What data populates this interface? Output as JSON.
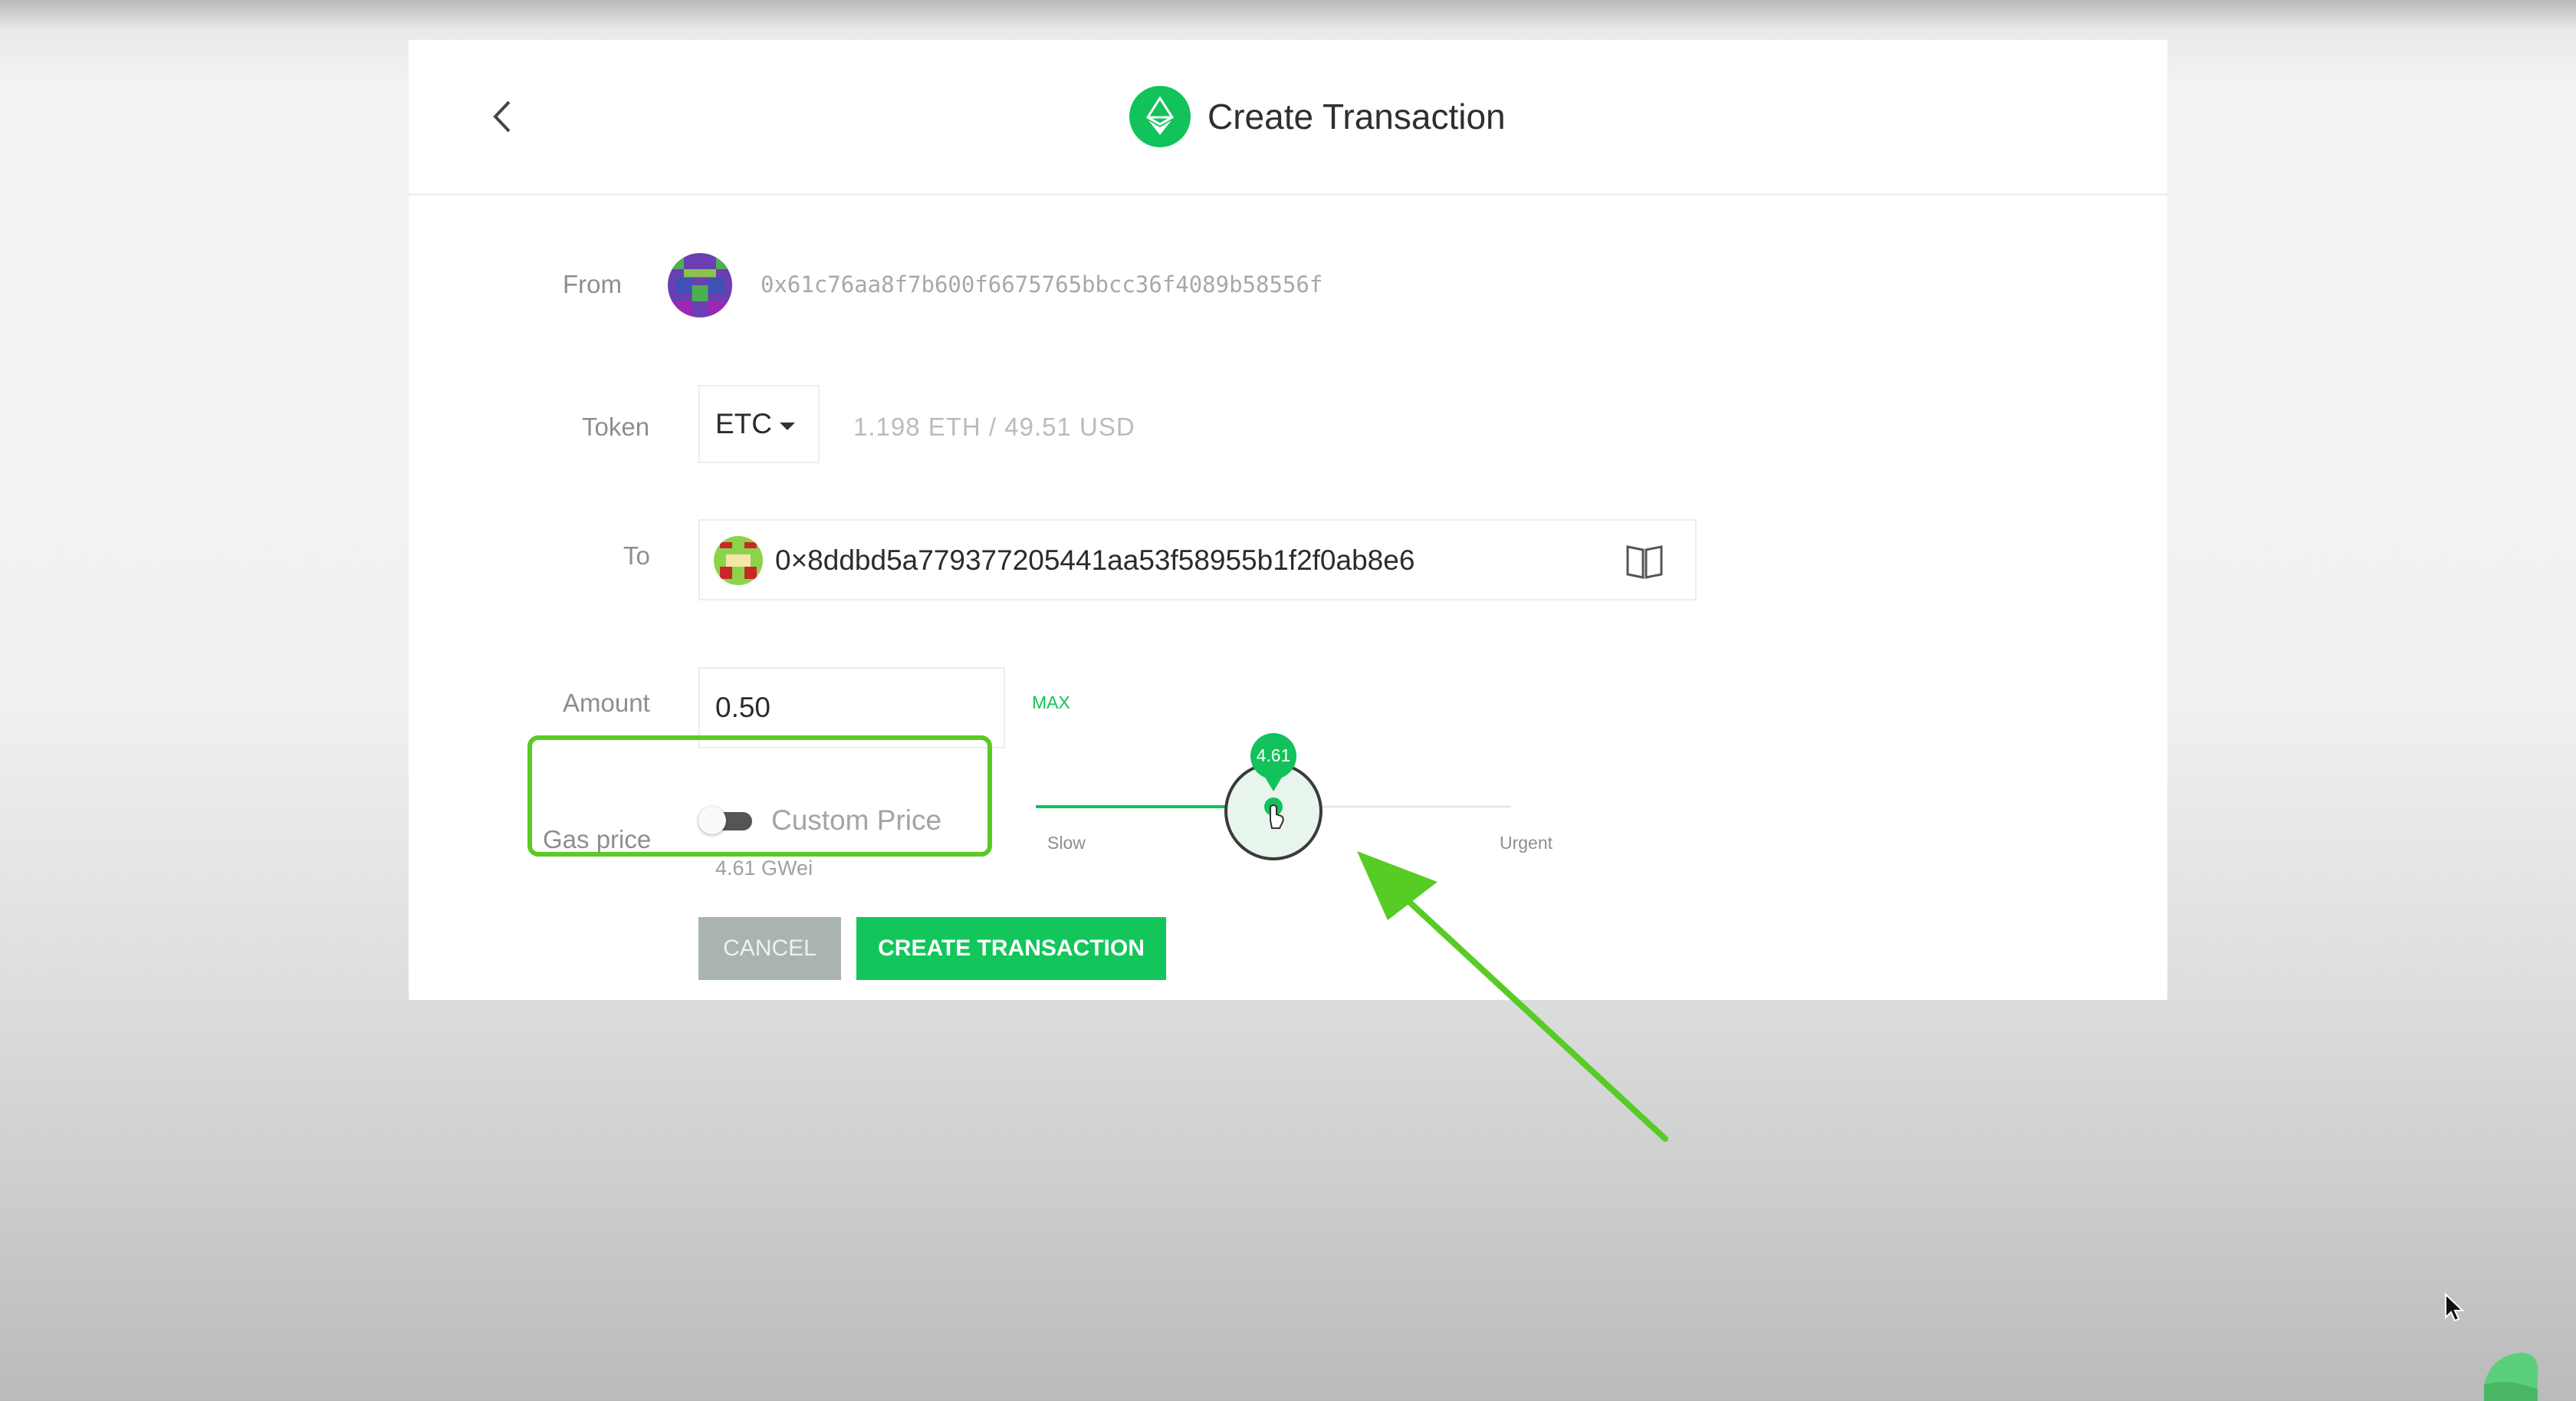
{
  "header": {
    "title": "Create Transaction"
  },
  "form": {
    "from_label": "From",
    "from_address": "0x61c76aa8f7b600f6675765bbcc36f4089b58556f",
    "token_label": "Token",
    "token_value": "ETC",
    "balance": "1.198  ETH  /  49.51  USD",
    "to_label": "To",
    "to_address": "0×8ddbd5a779377205441aa53f58955b1f2f0ab8e6",
    "amount_label": "Amount",
    "amount_value": "0.50",
    "max_label": "MAX",
    "gas_label": "Gas price",
    "custom_price_label": "Custom Price",
    "custom_price_enabled": false,
    "gas_value": "4.61 GWei"
  },
  "slider": {
    "value_label": "4.61",
    "slow_label": "Slow",
    "urgent_label": "Urgent",
    "level_fraction": 0.5
  },
  "buttons": {
    "cancel": "CANCEL",
    "create": "CREATE TRANSACTION"
  },
  "colors": {
    "accent": "#12c25a",
    "highlight": "#57cc24",
    "cancel_bg": "#a9b4ae"
  },
  "icons": {
    "back": "chevron-left-icon",
    "logo": "ethereum-icon",
    "address_book": "book-icon",
    "dropdown": "caret-down-icon"
  }
}
